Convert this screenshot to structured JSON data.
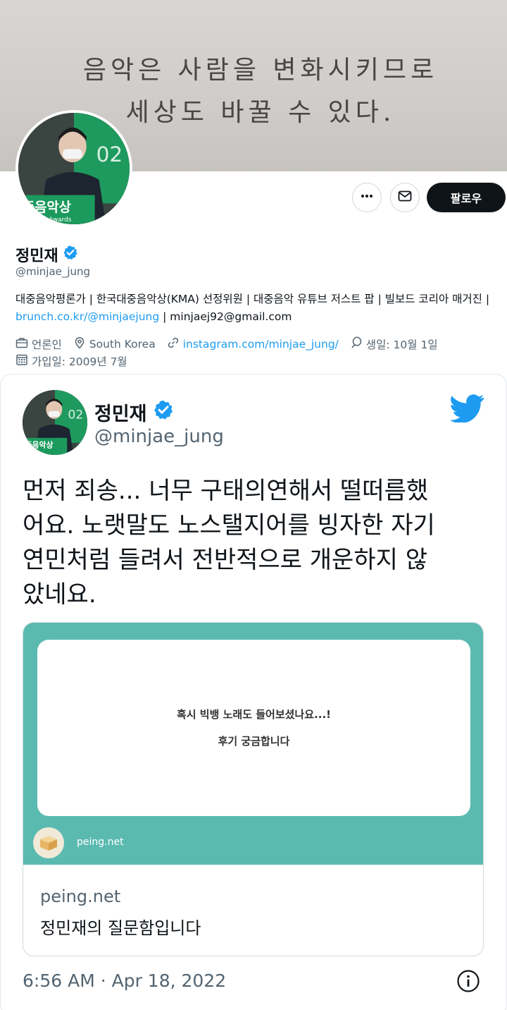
{
  "profile": {
    "banner": {
      "line1": "음악은 사람을 변화시키므로",
      "line2": "세상도 바꿀 수 있다."
    },
    "avatar_caption": {
      "line1": "중음악상",
      "line2": "usicAwards",
      "year": "02"
    },
    "actions": {
      "more_icon": "more-icon",
      "message_icon": "mail-icon",
      "follow_label": "팔로우"
    },
    "display_name": "정민재",
    "verified_icon": "verified-badge-icon",
    "handle": "@minjae_jung",
    "bio": {
      "text_before_link": "대중음악평론가 | 한국대중음악상(KMA) 선정위원 | 대중음악 유튜브 저스트 팝 | 빌보드 코리아 매거진 | ",
      "link": "brunch.co.kr/@minjaejung",
      "text_after_link": " | minjaej92@gmail.com"
    },
    "meta": {
      "category": "언론인",
      "location": "South Korea",
      "website": "instagram.com/minjae_jung/",
      "birthday": "생일: 10월 1일",
      "joined": "가입일: 2009년 7월"
    }
  },
  "tweet": {
    "author_name": "정민재",
    "author_handle": "@minjae_jung",
    "brand_icon": "twitter-bird-icon",
    "text_lines": [
      "먼저 죄송... 너무 구태의연해서 떨떠름했",
      "어요. 노랫말도 노스탤지어를 빙자한 자기",
      "연민처럼 들려서 전반적으로 개운하지 않",
      "았네요."
    ],
    "link_preview": {
      "question_line1": "혹시 빅뱅 노래도 들어보셨나요...!",
      "question_line2": "후기 궁금합니다",
      "image_site_label": "peing.net",
      "domain": "peing.net",
      "title": "정민재의 질문함입니다"
    },
    "timestamp": "6:56 AM · Apr 18, 2022",
    "info_icon": "info-icon"
  },
  "colors": {
    "accent_blue": "#1d9bf0",
    "preview_teal": "#5bbab0",
    "follow_button": "#0f1419",
    "secondary_text": "#536471"
  }
}
